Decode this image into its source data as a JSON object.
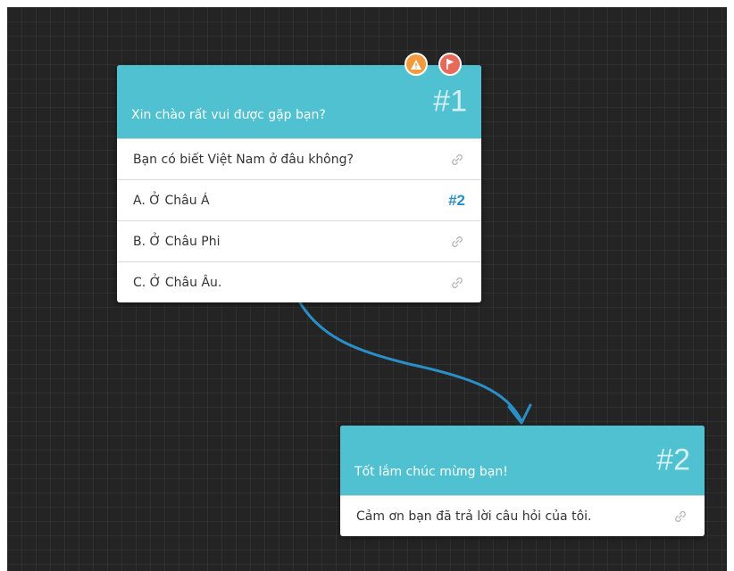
{
  "colors": {
    "canvas": "#242424",
    "header": "#4fc1d1",
    "connector": "#2a8fc7",
    "warning": "#f29b3e",
    "flag": "#e8685a"
  },
  "nodes": [
    {
      "title": "Xin chào rất vui được gặp bạn?",
      "number": "#1",
      "badges": [
        "warning-icon",
        "flag-icon"
      ],
      "rows": [
        {
          "text": "Bạn có biết Việt Nam ở đâu không?",
          "link": "link-icon"
        },
        {
          "text": "A. Ở Châu Á",
          "link": "#2"
        },
        {
          "text": "B. Ở Châu Phi",
          "link": "link-icon"
        },
        {
          "text": "C. Ở Châu Âu.",
          "link": "link-icon"
        }
      ]
    },
    {
      "title": "Tốt lắm chúc mừng bạn!",
      "number": "#2",
      "rows": [
        {
          "text": "Cảm ơn bạn đã trả lời câu hỏi của tôi.",
          "link": "link-icon"
        }
      ]
    }
  ]
}
